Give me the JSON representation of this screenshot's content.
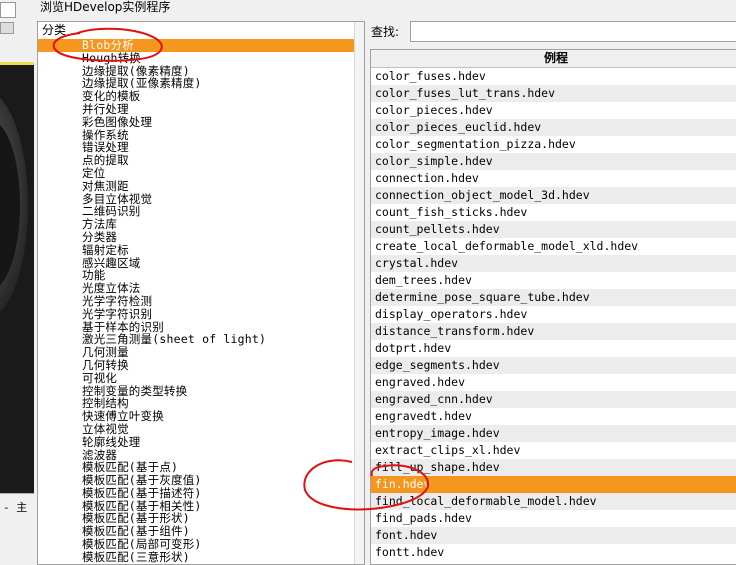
{
  "window": {
    "title": "浏览HDevelop实例程序"
  },
  "categories": {
    "header": "分类",
    "items": [
      {
        "label": "Blob分析",
        "selected": true
      },
      {
        "label": "Hough转换"
      },
      {
        "label": "边缘提取(像素精度)"
      },
      {
        "label": "边缘提取(亚像素精度)"
      },
      {
        "label": "变化的模板"
      },
      {
        "label": "并行处理"
      },
      {
        "label": "彩色图像处理"
      },
      {
        "label": "操作系统"
      },
      {
        "label": "错误处理"
      },
      {
        "label": "点的提取"
      },
      {
        "label": "定位"
      },
      {
        "label": "对焦测距"
      },
      {
        "label": "多目立体视觉"
      },
      {
        "label": "二维码识别"
      },
      {
        "label": "方法库"
      },
      {
        "label": "分类器"
      },
      {
        "label": "辐射定标"
      },
      {
        "label": "感兴趣区域"
      },
      {
        "label": "功能"
      },
      {
        "label": "光度立体法"
      },
      {
        "label": "光学字符检测"
      },
      {
        "label": "光学字符识别"
      },
      {
        "label": "基于样本的识别"
      },
      {
        "label": "激光三角测量(sheet of light)"
      },
      {
        "label": "几何测量"
      },
      {
        "label": "几何转换"
      },
      {
        "label": "可视化"
      },
      {
        "label": "控制变量的类型转换"
      },
      {
        "label": "控制结构"
      },
      {
        "label": "快速傅立叶变换"
      },
      {
        "label": "立体视觉"
      },
      {
        "label": "轮廓线处理"
      },
      {
        "label": "滤波器"
      },
      {
        "label": "模板匹配(基于点)"
      },
      {
        "label": "模板匹配(基于灰度值)"
      },
      {
        "label": "模板匹配(基于描述符)"
      },
      {
        "label": "模板匹配(基于相关性)"
      },
      {
        "label": "模板匹配(基于形状)"
      },
      {
        "label": "模板匹配(基于组件)"
      },
      {
        "label": "模板匹配(局部可变形)"
      },
      {
        "label": "模板匹配(三意形状)"
      }
    ]
  },
  "search": {
    "label": "查找:",
    "value": ""
  },
  "examples": {
    "header": "例程",
    "items": [
      {
        "label": "color_fuses.hdev"
      },
      {
        "label": "color_fuses_lut_trans.hdev"
      },
      {
        "label": "color_pieces.hdev"
      },
      {
        "label": "color_pieces_euclid.hdev"
      },
      {
        "label": "color_segmentation_pizza.hdev"
      },
      {
        "label": "color_simple.hdev"
      },
      {
        "label": "connection.hdev"
      },
      {
        "label": "connection_object_model_3d.hdev"
      },
      {
        "label": "count_fish_sticks.hdev"
      },
      {
        "label": "count_pellets.hdev"
      },
      {
        "label": "create_local_deformable_model_xld.hdev"
      },
      {
        "label": "crystal.hdev"
      },
      {
        "label": "dem_trees.hdev"
      },
      {
        "label": "determine_pose_square_tube.hdev"
      },
      {
        "label": "display_operators.hdev"
      },
      {
        "label": "distance_transform.hdev"
      },
      {
        "label": "dotprt.hdev"
      },
      {
        "label": "edge_segments.hdev"
      },
      {
        "label": "engraved.hdev"
      },
      {
        "label": "engraved_cnn.hdev"
      },
      {
        "label": "engravedt.hdev"
      },
      {
        "label": "entropy_image.hdev"
      },
      {
        "label": "extract_clips_xl.hdev"
      },
      {
        "label": "fill_up_shape.hdev"
      },
      {
        "label": "fin.hdev",
        "selected": true
      },
      {
        "label": "find_local_deformable_model.hdev"
      },
      {
        "label": "find_pads.hdev"
      },
      {
        "label": "font.hdev"
      },
      {
        "label": "fontt.hdev"
      }
    ]
  },
  "background_app": {
    "toolbar_text": "- 主"
  },
  "colors": {
    "selection": "#f5961e",
    "annotation": "#e01010"
  }
}
